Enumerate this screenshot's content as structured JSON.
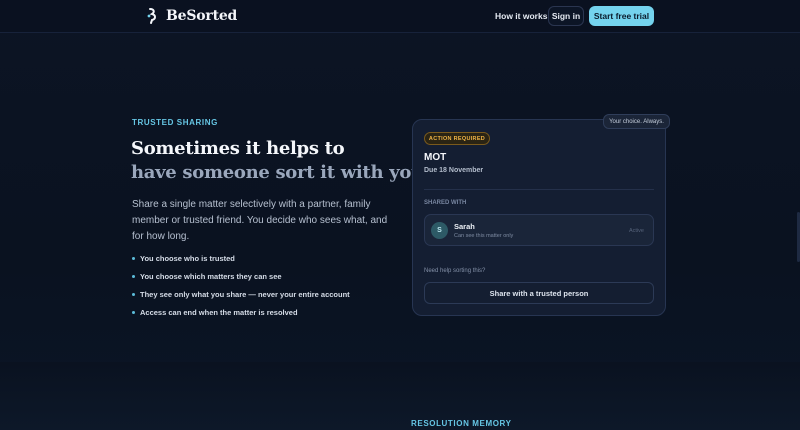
{
  "header": {
    "brand": "BeSorted",
    "nav_how": "How it works",
    "sign_in": "Sign in",
    "cta": "Start free trial"
  },
  "section": {
    "eyebrow": "TRUSTED SHARING",
    "headline_line1": "Sometimes it helps to",
    "headline_line2": "have someone sort it with you.",
    "lede": "Share a single matter selectively with a partner, family member or trusted friend. You decide who sees what, and for how long.",
    "bullets": [
      "You choose who is trusted",
      "You choose which matters they can see",
      "They see only what you share — never your entire account",
      "Access can end when the matter is resolved"
    ]
  },
  "card": {
    "tooltip": "Your choice. Always.",
    "badge": "ACTION REQUIRED",
    "title": "MOT",
    "due": "Due 18 November",
    "shared_label": "SHARED WITH",
    "person": {
      "initial": "S",
      "name": "Sarah",
      "subtitle": "Can see this matter only",
      "status": "Active"
    },
    "help": "Need help sorting this?",
    "share_button": "Share with a trusted person"
  },
  "next_section": {
    "eyebrow": "RESOLUTION MEMORY"
  },
  "colors": {
    "background": "#0b1322",
    "accent": "#74d3ee",
    "badge": "#f0b546"
  }
}
